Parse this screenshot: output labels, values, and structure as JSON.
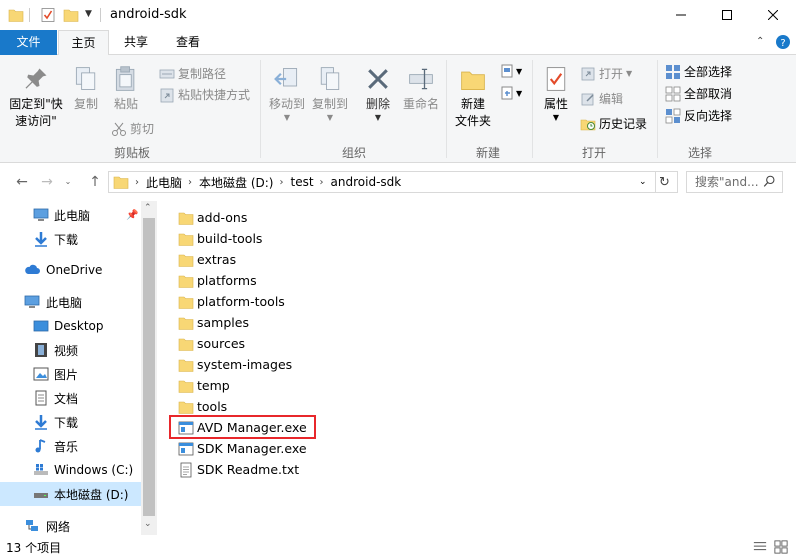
{
  "window": {
    "title": "android-sdk"
  },
  "ribbon_tabs": [
    {
      "label": "文件"
    },
    {
      "label": "主页"
    },
    {
      "label": "共享"
    },
    {
      "label": "查看"
    }
  ],
  "ribbon": {
    "pin_label_1": "固定到\"快",
    "pin_label_2": "速访问\"",
    "copy_label": "复制",
    "paste_label": "粘贴",
    "copy_path_label": "复制路径",
    "paste_shortcut_label": "粘贴快捷方式",
    "cut_label": "剪切",
    "clipboard_group": "剪贴板",
    "move_to_label": "移动到",
    "copy_to_label": "复制到",
    "delete_label": "删除",
    "rename_label": "重命名",
    "organize_group": "组织",
    "new_folder_label_1": "新建",
    "new_folder_label_2": "文件夹",
    "new_group": "新建",
    "properties_label": "属性",
    "open_label": "打开",
    "edit_label": "编辑",
    "history_label": "历史记录",
    "open_group": "打开",
    "select_all_label": "全部选择",
    "select_none_label": "全部取消",
    "invert_selection_label": "反向选择",
    "select_group": "选择"
  },
  "address": {
    "segments": [
      "此电脑",
      "本地磁盘 (D:)",
      "test",
      "android-sdk"
    ],
    "search_placeholder": "搜索\"and..."
  },
  "nav_pane": {
    "items": [
      {
        "label": "此电脑",
        "icon": "pc-icon"
      },
      {
        "label": "下载",
        "icon": "download-icon"
      },
      {
        "label": "OneDrive",
        "icon": "cloud-icon"
      },
      {
        "label": "此电脑",
        "icon": "pc-icon"
      },
      {
        "label": "Desktop",
        "icon": "desktop-icon"
      },
      {
        "label": "视频",
        "icon": "video-icon"
      },
      {
        "label": "图片",
        "icon": "picture-icon"
      },
      {
        "label": "文档",
        "icon": "document-icon"
      },
      {
        "label": "下载",
        "icon": "download-icon"
      },
      {
        "label": "音乐",
        "icon": "music-icon"
      },
      {
        "label": "Windows (C:)",
        "icon": "drive-icon"
      },
      {
        "label": "本地磁盘 (D:)",
        "icon": "drive-icon"
      },
      {
        "label": "网络",
        "icon": "network-icon"
      }
    ]
  },
  "files": [
    {
      "name": "add-ons",
      "type": "folder"
    },
    {
      "name": "build-tools",
      "type": "folder"
    },
    {
      "name": "extras",
      "type": "folder"
    },
    {
      "name": "platforms",
      "type": "folder"
    },
    {
      "name": "platform-tools",
      "type": "folder"
    },
    {
      "name": "samples",
      "type": "folder"
    },
    {
      "name": "sources",
      "type": "folder"
    },
    {
      "name": "system-images",
      "type": "folder"
    },
    {
      "name": "temp",
      "type": "folder"
    },
    {
      "name": "tools",
      "type": "folder"
    },
    {
      "name": "AVD Manager.exe",
      "type": "exe"
    },
    {
      "name": "SDK Manager.exe",
      "type": "exe"
    },
    {
      "name": "SDK Readme.txt",
      "type": "txt"
    }
  ],
  "status": {
    "item_count": "13 个项目"
  },
  "colors": {
    "accent": "#1979ca",
    "selection": "#cce8ff",
    "highlight_border": "#e8272b",
    "folder": "#f8d775"
  }
}
